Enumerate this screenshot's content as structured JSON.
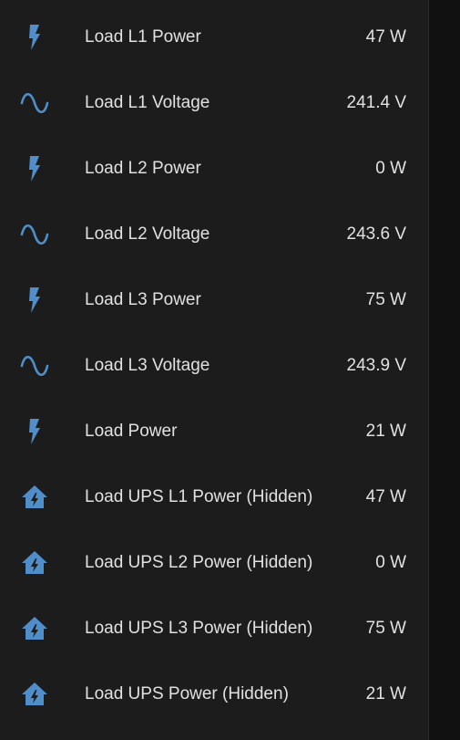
{
  "accent_color": "#4f8ec9",
  "entities": [
    {
      "icon": "flash-icon",
      "label": "Load L1 Power",
      "value": "47 W"
    },
    {
      "icon": "sine-wave-icon",
      "label": "Load L1 Voltage",
      "value": "241.4 V"
    },
    {
      "icon": "flash-icon",
      "label": "Load L2 Power",
      "value": "0 W"
    },
    {
      "icon": "sine-wave-icon",
      "label": "Load L2 Voltage",
      "value": "243.6 V"
    },
    {
      "icon": "flash-icon",
      "label": "Load L3 Power",
      "value": "75 W"
    },
    {
      "icon": "sine-wave-icon",
      "label": "Load L3 Voltage",
      "value": "243.9 V"
    },
    {
      "icon": "flash-icon",
      "label": "Load Power",
      "value": "21 W"
    },
    {
      "icon": "home-lightning-icon",
      "label": "Load UPS L1 Power (Hidden)",
      "value": "47 W"
    },
    {
      "icon": "home-lightning-icon",
      "label": "Load UPS L2 Power (Hidden)",
      "value": "0 W"
    },
    {
      "icon": "home-lightning-icon",
      "label": "Load UPS L3 Power (Hidden)",
      "value": "75 W"
    },
    {
      "icon": "home-lightning-icon",
      "label": "Load UPS Power (Hidden)",
      "value": "21 W"
    }
  ]
}
